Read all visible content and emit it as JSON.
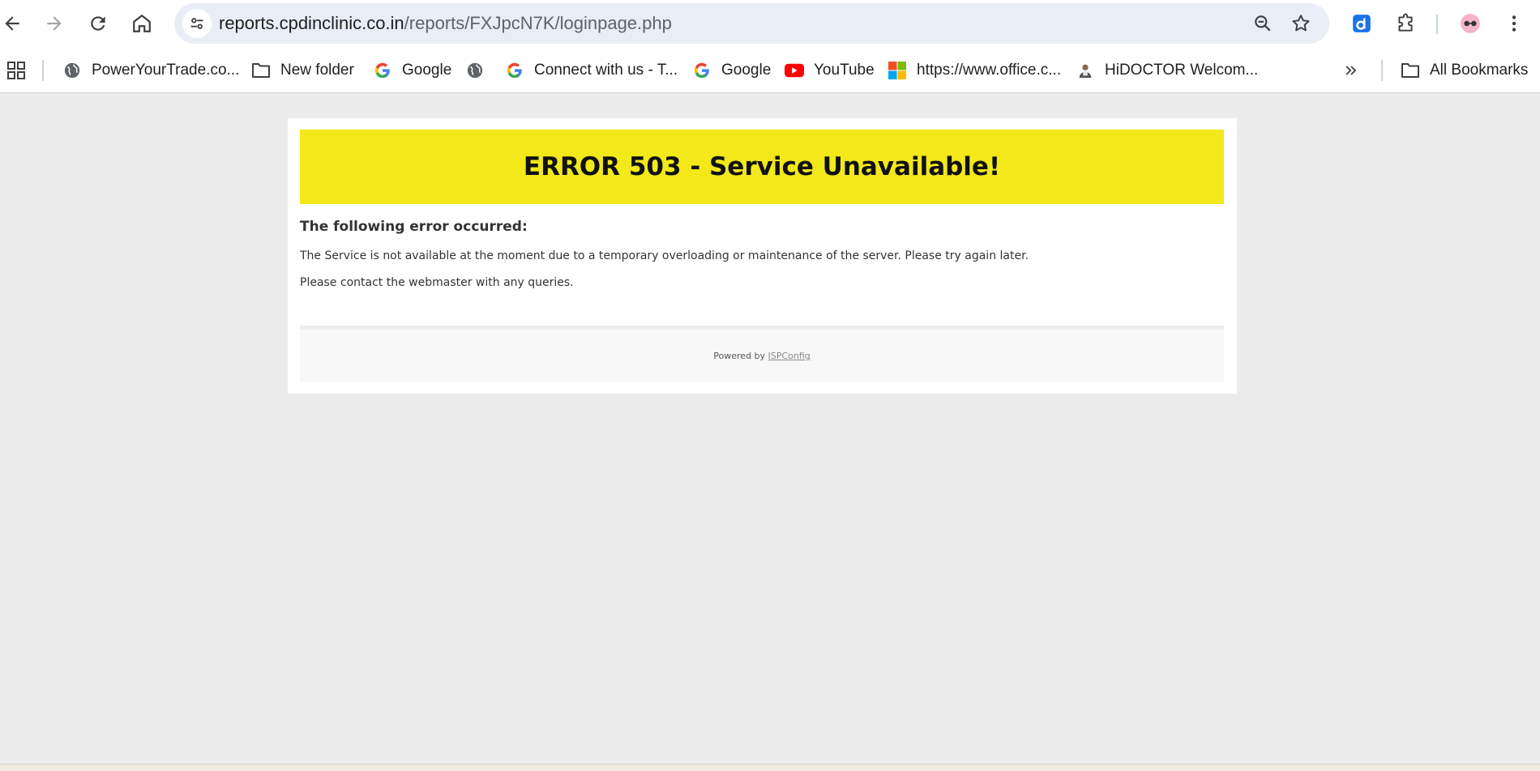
{
  "browser": {
    "url_host": "reports.cpdinclinic.co.in",
    "url_path": "/reports/FXJpcN7K/loginpage.php",
    "accent_color": "#1a73e8"
  },
  "bookmarks": {
    "items": [
      {
        "label": "PowerYourTrade.co...",
        "icon": "globe-icon"
      },
      {
        "label": "New folder",
        "icon": "folder-icon"
      },
      {
        "label": "Google",
        "icon": "google-icon"
      },
      {
        "label": "",
        "icon": "globe-icon"
      },
      {
        "label": "Connect with us - T...",
        "icon": "google-icon"
      },
      {
        "label": "Google",
        "icon": "google-icon"
      },
      {
        "label": "YouTube",
        "icon": "youtube-icon"
      },
      {
        "label": "https://www.office.c...",
        "icon": "microsoft-icon"
      },
      {
        "label": "HiDOCTOR Welcom...",
        "icon": "hidoctor-icon"
      }
    ],
    "all_bookmarks_label": "All Bookmarks"
  },
  "page": {
    "banner_title": "ERROR 503 - Service Unavailable!",
    "banner_color": "#f2e81a",
    "error_heading": "The following error occurred:",
    "error_message": "The Service is not available at the moment due to a temporary overloading or maintenance of the server. Please try again later.",
    "contact_message": "Please contact the webmaster with any queries.",
    "powered_by_label": "Powered by",
    "powered_by_link": "ISPConfig"
  }
}
